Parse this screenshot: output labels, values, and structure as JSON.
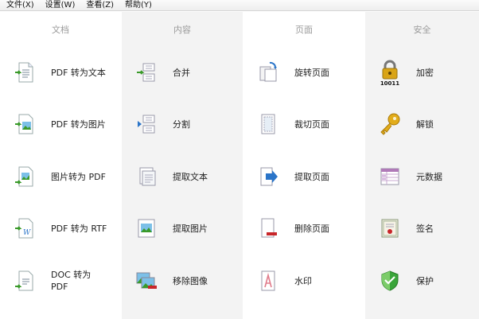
{
  "menu": [
    {
      "label": "文件(X)"
    },
    {
      "label": "设置(W)"
    },
    {
      "label": "查看(Z)"
    },
    {
      "label": "帮助(Y)"
    }
  ],
  "columns": [
    {
      "title": "文档",
      "items": [
        {
          "label": "PDF 转为文本",
          "icon": "pdf-to-text-icon"
        },
        {
          "label": "PDF 转为图片",
          "icon": "pdf-to-image-icon"
        },
        {
          "label": "图片转为 PDF",
          "icon": "image-to-pdf-icon"
        },
        {
          "label": "PDF 转为 RTF",
          "icon": "pdf-to-rtf-icon"
        },
        {
          "label": "DOC 转为\nPDF",
          "icon": "doc-to-pdf-icon"
        }
      ]
    },
    {
      "title": "内容",
      "items": [
        {
          "label": "合并",
          "icon": "merge-icon"
        },
        {
          "label": "分割",
          "icon": "split-icon"
        },
        {
          "label": "提取文本",
          "icon": "extract-text-icon"
        },
        {
          "label": "提取图片",
          "icon": "extract-image-icon"
        },
        {
          "label": "移除图像",
          "icon": "remove-image-icon"
        }
      ]
    },
    {
      "title": "页面",
      "items": [
        {
          "label": "旋转页面",
          "icon": "rotate-page-icon"
        },
        {
          "label": "裁切页面",
          "icon": "crop-page-icon"
        },
        {
          "label": "提取页面",
          "icon": "extract-page-icon"
        },
        {
          "label": "删除页面",
          "icon": "delete-page-icon"
        },
        {
          "label": "水印",
          "icon": "watermark-icon"
        }
      ]
    },
    {
      "title": "安全",
      "items": [
        {
          "label": "加密",
          "icon": "lock-icon",
          "icon_text": "10011"
        },
        {
          "label": "解锁",
          "icon": "key-icon"
        },
        {
          "label": "元数据",
          "icon": "metadata-icon"
        },
        {
          "label": "签名",
          "icon": "certificate-icon"
        },
        {
          "label": "保护",
          "icon": "shield-icon"
        }
      ]
    }
  ],
  "colors": {
    "shade": "#f3f3f3",
    "green_arrow": "#3a9a2a",
    "blue_arrow": "#2a74c8",
    "red_bar": "#c8262a",
    "lock_gold": "#d9a416",
    "shield_green": "#3aa53a"
  }
}
